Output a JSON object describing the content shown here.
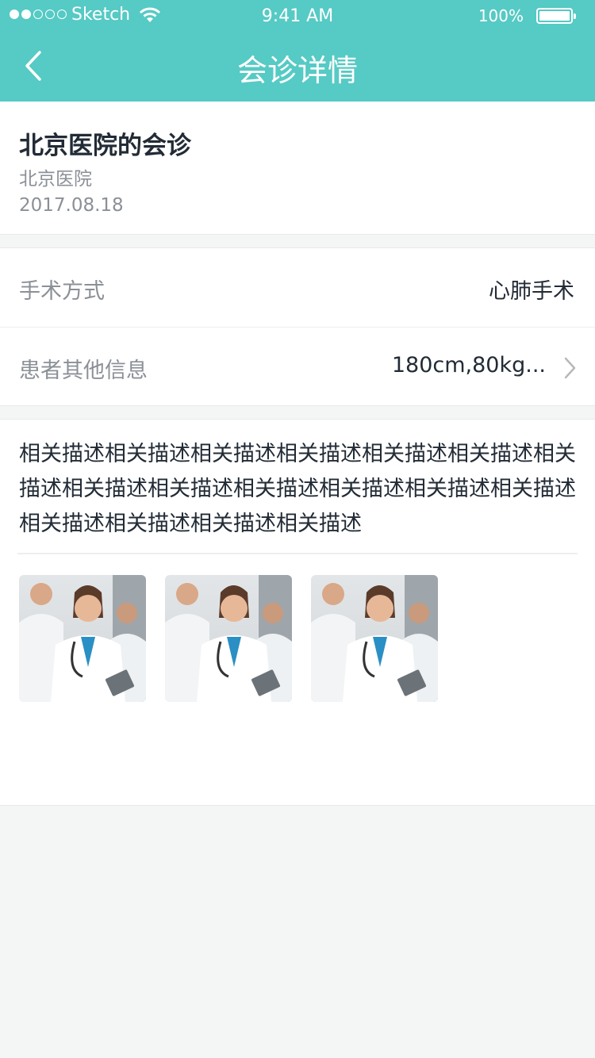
{
  "status_bar": {
    "carrier": "Sketch",
    "time": "9:41 AM",
    "battery": "100%"
  },
  "nav": {
    "title": "会诊详情",
    "back_icon": "chevron-left-icon"
  },
  "consultation": {
    "title": "北京医院的会诊",
    "hospital": "北京医院",
    "date": "2017.08.18"
  },
  "rows": [
    {
      "label": "手术方式",
      "value": "心肺手术"
    },
    {
      "label": "患者其他信息",
      "value": "180cm,80kg..."
    }
  ],
  "description": "相关描述相关描述相关描述相关描述相关描述相关描述相关描述相关描述相关描述相关描述相关描述相关描述相关描述相关描述相关描述相关描述相关描述",
  "photos": [
    "doctors-photo",
    "doctors-photo",
    "doctors-photo"
  ],
  "colors": {
    "accent": "#56cac4",
    "text_primary": "#222b36",
    "text_secondary": "#8b9097",
    "background": "#f4f5f5"
  }
}
